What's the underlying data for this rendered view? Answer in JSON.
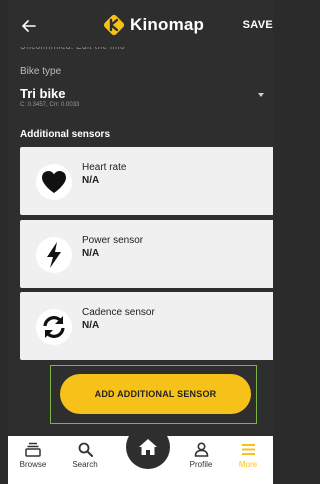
{
  "header": {
    "logo_text": "Kinomap",
    "save_label": "SAVE",
    "cut_text": "Unconfirmed. Edit the info"
  },
  "bike": {
    "label": "Bike type",
    "value": "Tri bike",
    "sub": "C: 0.3457, Crr: 0.0033"
  },
  "sensors": {
    "title": "Additional sensors",
    "items": [
      {
        "name": "Heart rate",
        "value": "N/A",
        "icon": "heart-icon"
      },
      {
        "name": "Power sensor",
        "value": "N/A",
        "icon": "lightning-icon"
      },
      {
        "name": "Cadence sensor",
        "value": "N/A",
        "icon": "sync-icon"
      }
    ]
  },
  "add_button": {
    "label": "ADD ADDITIONAL SENSOR"
  },
  "nav": {
    "items": [
      {
        "label": "Browse",
        "icon": "browse-icon"
      },
      {
        "label": "Search",
        "icon": "search-icon"
      },
      {
        "label": "Profile",
        "icon": "profile-icon"
      },
      {
        "label": "More",
        "icon": "menu-icon"
      }
    ],
    "active": "More"
  },
  "colors": {
    "accent": "#f6c21a",
    "background": "#2e2e2e",
    "card": "#f0f0f0"
  }
}
